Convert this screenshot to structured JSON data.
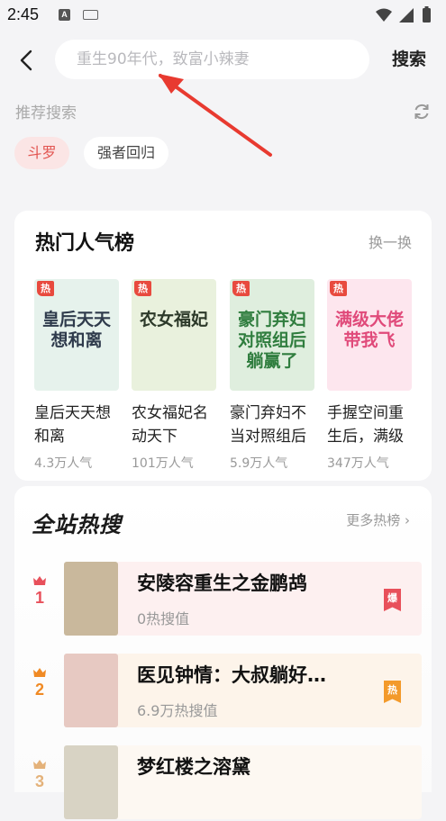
{
  "status": {
    "time": "2:45"
  },
  "header": {
    "search_placeholder": "重生90年代，致富小辣妻",
    "search_button": "搜索"
  },
  "recommended": {
    "title": "推荐搜索",
    "chips": [
      "斗罗",
      "强者回归"
    ]
  },
  "popular": {
    "title": "热门人气榜",
    "more": "换一换",
    "hot_tag": "热",
    "books": [
      {
        "name": "皇后天天想和离",
        "popularity": "4.3万人气",
        "cover_text": "皇后天天想和离",
        "cover_bg": "#e6f2ec",
        "cover_color": "#2f3b4c"
      },
      {
        "name": "农女福妃名动天下",
        "popularity": "101万人气",
        "cover_text": "农女福妃",
        "cover_bg": "#e9f1dd",
        "cover_color": "#2d3a2a"
      },
      {
        "name": "豪门弃妇不当对照组后躺赢了",
        "popularity": "5.9万人气",
        "cover_text": "豪门弃妇对照组后躺赢了",
        "cover_bg": "#dfeede",
        "cover_color": "#2f7d3e"
      },
      {
        "name": "手握空间重生后，满级大佬带我飞",
        "popularity": "347万人气",
        "cover_text": "满级大佬带我飞",
        "cover_bg": "#fde6ee",
        "cover_color": "#e04a7a"
      }
    ]
  },
  "ranking": {
    "title": "全站热搜",
    "more": "更多热榜 ›",
    "items": [
      {
        "rank": "1",
        "name": "安陵容重生之金鹏鸪",
        "heat": "0热搜值",
        "badge": "爆",
        "rank_color": "#e8505b",
        "badge_color": "#e8505b",
        "bg": "#fdf0f0",
        "cover_bg": "#c9b89c"
      },
      {
        "rank": "2",
        "name": "医见钟情：大叔躺好…",
        "heat": "6.9万热搜值",
        "badge": "热",
        "rank_color": "#f08a24",
        "badge_color": "#f39a2b",
        "bg": "#fdf4ea",
        "cover_bg": "#e7c9c2"
      },
      {
        "rank": "3",
        "name": "梦红楼之溶黛",
        "heat": "",
        "badge": "",
        "rank_color": "#e4b27a",
        "badge_color": "#e4b27a",
        "bg": "#fdf8f2",
        "cover_bg": "#d8d3c4"
      }
    ]
  },
  "colors": {
    "accent_red": "#e8505b",
    "page_bg": "#f4f4f6"
  }
}
